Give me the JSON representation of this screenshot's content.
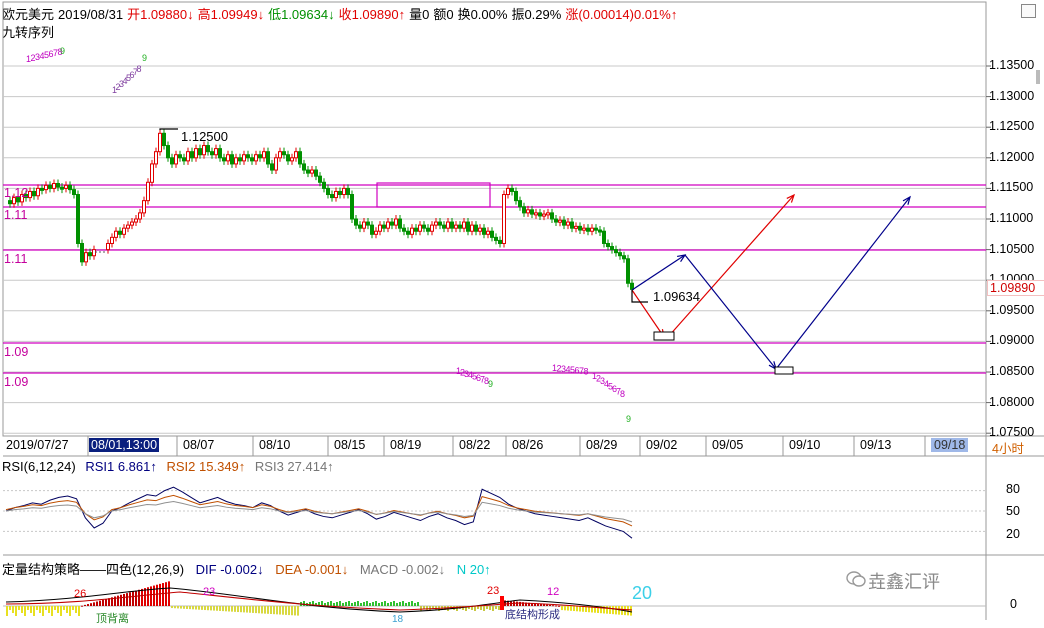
{
  "header": {
    "symbol": "欧元美元",
    "date": "2019/08/31",
    "open": "开1.09880↓",
    "high": "高1.09949↓",
    "low": "低1.09634↓",
    "close": "收1.09890↑",
    "volume": "量0",
    "amount": "额0",
    "turnover": "换0.00%",
    "amplitude": "振0.29%",
    "change": "涨(0.00014)0.01%↑"
  },
  "series_label": "九转序列",
  "price_axis": [
    "1.13500",
    "1.13000",
    "1.12500",
    "1.12000",
    "1.11500",
    "1.11000",
    "1.10500",
    "1.10000",
    "1.09500",
    "1.09000",
    "1.08500",
    "1.08000",
    "1.07500"
  ],
  "current_price": "1.09890",
  "hline_labels": [
    "1.12",
    "1.11",
    "1.11",
    "1.09",
    "1.09"
  ],
  "annotations": {
    "high_price": "1.12500",
    "low_price": "1.09634"
  },
  "dates": [
    "2019/07/27",
    "08/01,13:00",
    "08/07",
    "08/10",
    "08/15",
    "08/19",
    "08/22",
    "08/26",
    "08/29",
    "09/02",
    "09/05",
    "09/10",
    "09/13",
    "09/18"
  ],
  "timeframe": "4小时",
  "rsi": {
    "title": "RSI(6,12,24)",
    "rsi1": "RSI1 6.861↑",
    "rsi2": "RSI2 15.349↑",
    "rsi3": "RSI3 27.414↑",
    "levels": [
      "80",
      "50",
      "20"
    ]
  },
  "macd": {
    "title": "定量结构策略——四色(12,26,9)",
    "dif": "DIF -0.002↓",
    "dea": "DEA -0.001↓",
    "macd": "MACD -0.002↓",
    "n": "N 20↑",
    "zero": "0",
    "big_count": "20",
    "tag1": "26",
    "tag2": "23",
    "tag3": "23",
    "tag4": "12",
    "tag5": "18",
    "tag6": "顶背离",
    "tag7": "底结构形成"
  },
  "seq_numbers": [
    "1",
    "2",
    "3",
    "4",
    "5",
    "6",
    "7",
    "8",
    "9"
  ],
  "watermark": "垚鑫汇评",
  "colors": {
    "bull": "#e00000",
    "bear": "#009000",
    "magenta": "#d000c0",
    "grid": "#c8c8c8",
    "navy": "#00008b"
  }
}
